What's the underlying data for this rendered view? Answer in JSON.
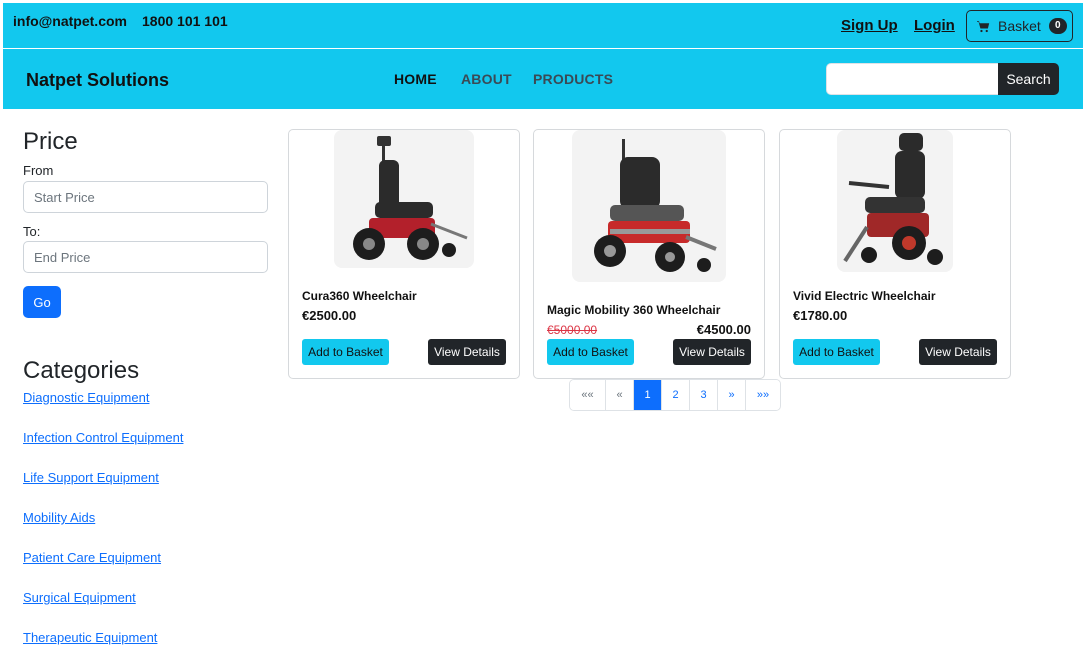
{
  "topbar": {
    "email": "info@natpet.com",
    "phone": "1800 101 101",
    "signup": "Sign Up",
    "login": "Login",
    "basket_label": "Basket",
    "basket_count": "0",
    "basket_icon": "cart-icon"
  },
  "navbar": {
    "brand": "Natpet Solutions",
    "links": [
      "HOME",
      "ABOUT",
      "PRODUCTS"
    ],
    "search_value": "",
    "search_button": "Search"
  },
  "sidebar": {
    "price_heading": "Price",
    "from_label": "From",
    "from_placeholder": "Start Price",
    "to_label": "To:",
    "to_placeholder": "End Price",
    "go_button": "Go",
    "categories_heading": "Categories",
    "categories": [
      "Diagnostic Equipment",
      "Infection Control Equipment",
      "Life Support Equipment",
      "Mobility Aids",
      "Patient Care Equipment",
      "Surgical Equipment",
      "Therapeutic Equipment"
    ]
  },
  "products": [
    {
      "name": "Cura360 Wheelchair",
      "price": "€2500.00",
      "old_price": "",
      "add_label": "Add to Basket",
      "view_label": "View Details"
    },
    {
      "name": "Magic Mobility 360 Wheelchair",
      "price": "€4500.00",
      "old_price": "€5000.00",
      "add_label": "Add to Basket",
      "view_label": "View Details"
    },
    {
      "name": "Vivid Electric Wheelchair",
      "price": "€1780.00",
      "old_price": "",
      "add_label": "Add to Basket",
      "view_label": "View Details"
    }
  ],
  "pagination": {
    "items": [
      "««",
      "«",
      "1",
      "2",
      "3",
      "»",
      "»»"
    ],
    "active": "1"
  },
  "colors": {
    "header_bg": "#12c8ee",
    "primary": "#0d6efd",
    "dark": "#212529",
    "sale_red": "#dc3545"
  }
}
